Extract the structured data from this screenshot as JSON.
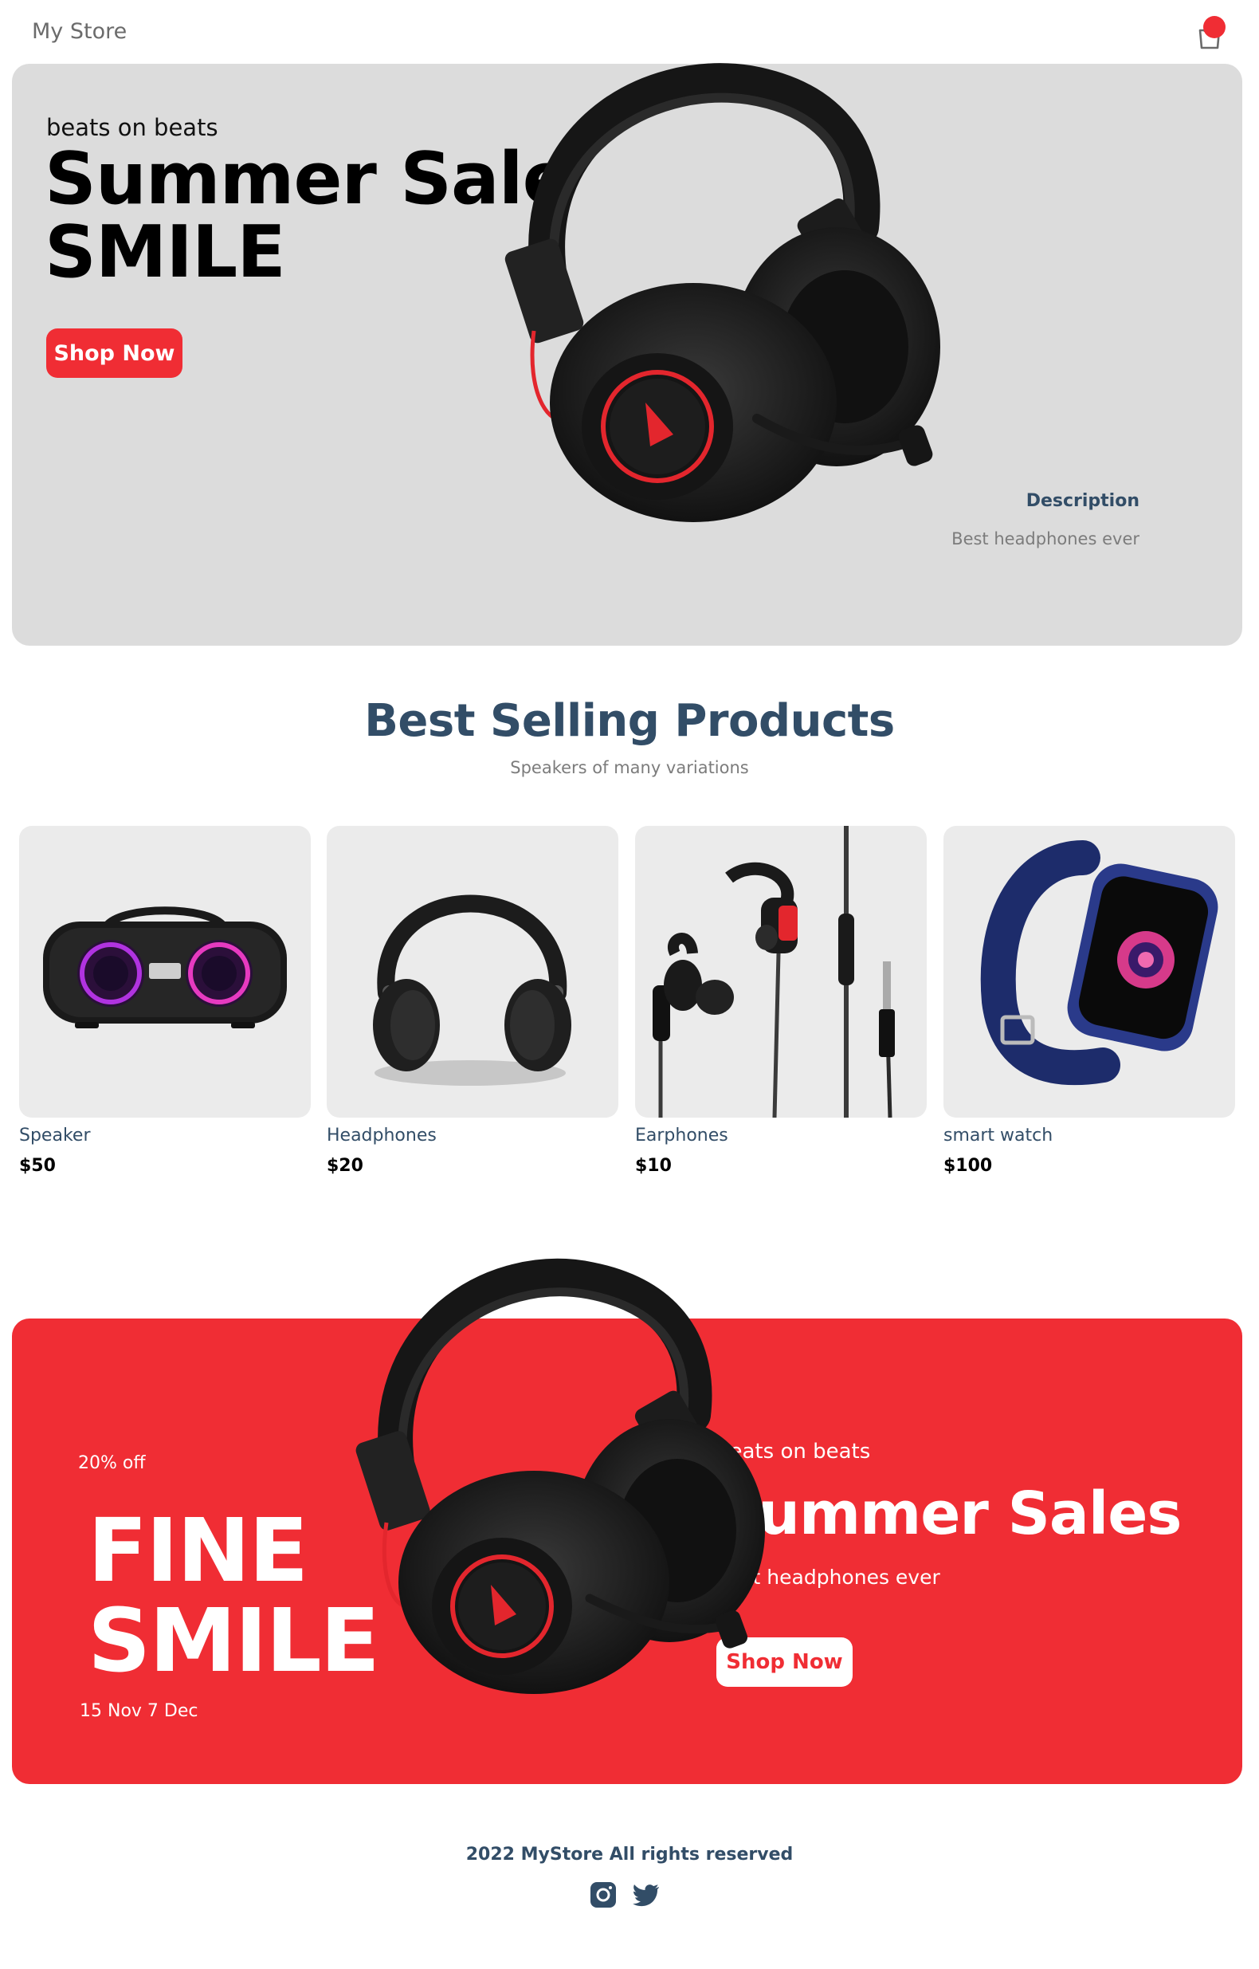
{
  "navbar": {
    "logo": "My Store",
    "cart_icon": "cart-icon",
    "accent": "#f02d34"
  },
  "hero": {
    "small_text": "beats on beats",
    "mid_text": "Summer Sale",
    "large_text": "SMILE",
    "button": "Shop Now",
    "desc_title": "Description",
    "desc_text": "Best headphones ever",
    "background": "#dcdcdc"
  },
  "products": {
    "heading": "Best Selling Products",
    "subheading": "Speakers of many variations",
    "items": [
      {
        "name": "Speaker",
        "price": "$50"
      },
      {
        "name": "Headphones",
        "price": "$20"
      },
      {
        "name": "Earphones",
        "price": "$10"
      },
      {
        "name": "smart watch",
        "price": "$100"
      }
    ]
  },
  "footer_banner": {
    "discount": "20% off",
    "large1": "FINE",
    "large2": "SMILE",
    "time": "15 Nov 7 Dec",
    "small_text": "beats on beats",
    "mid_text": "Summer Sales",
    "desc": "Best headphones ever",
    "button": "Shop Now",
    "background": "#f02d34"
  },
  "footer": {
    "copyright": "2022 MyStore All rights reserved",
    "icons": [
      "instagram-icon",
      "twitter-icon"
    ]
  }
}
